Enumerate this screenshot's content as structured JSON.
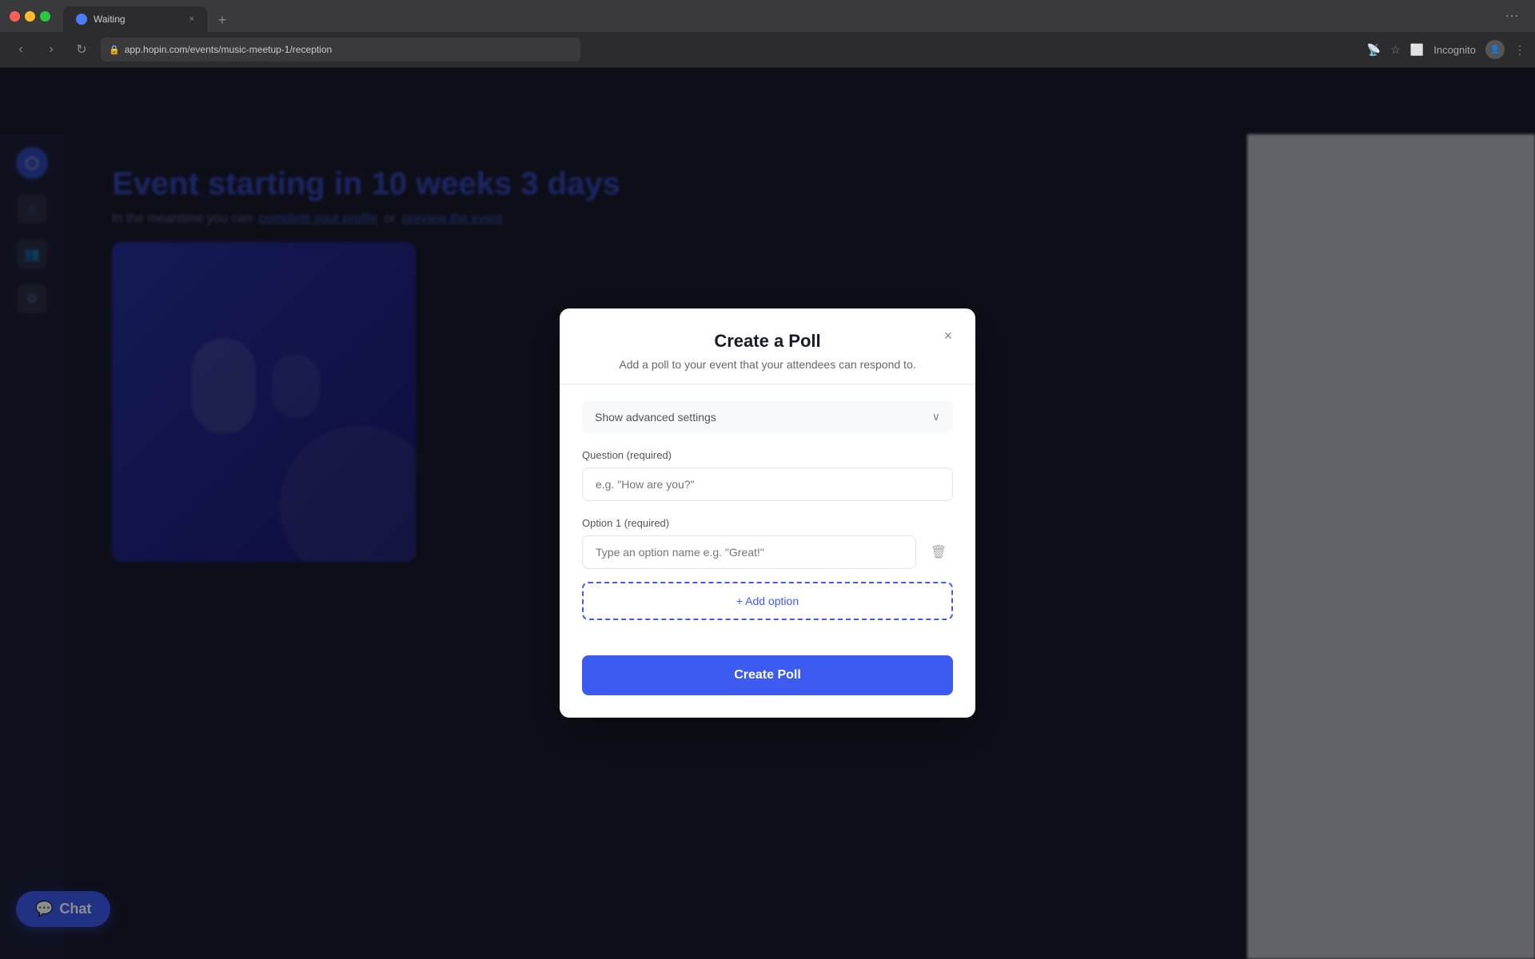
{
  "browser": {
    "tab_title": "Waiting",
    "url": "app.hopin.com/events/music-meetup-1/reception",
    "tab_close": "×",
    "tab_new": "+",
    "nav_back": "‹",
    "nav_forward": "›",
    "nav_refresh": "↻",
    "incognito_label": "Incognito",
    "more_icon": "⋮",
    "chevron_down": "⌄"
  },
  "page": {
    "event_title": "Event starting in 10 weeks 3 days",
    "event_subtitle_prefix": "In the meantime you can",
    "event_subtitle_link1": "complete your profile",
    "event_subtitle_mid": "or",
    "event_subtitle_link2": "preview the event"
  },
  "chat_button": {
    "label": "Chat",
    "icon": "💬"
  },
  "modal": {
    "title": "Create a Poll",
    "subtitle": "Add a poll to your event that your attendees can respond to.",
    "close_icon": "×",
    "advanced_settings_label": "Show advanced settings",
    "chevron_icon": "∨",
    "question_label": "Question (required)",
    "question_placeholder": "e.g. \"How are you?\"",
    "option1_label": "Option 1 (required)",
    "option1_placeholder": "Type an option name e.g. \"Great!\"",
    "add_option_label": "+ Add option",
    "create_poll_label": "Create Poll",
    "delete_icon": "🗑"
  },
  "colors": {
    "accent": "#3d5af1",
    "border": "#e0e4ea",
    "bg_light": "#f8f9fa",
    "text_dark": "#1a1a2e",
    "text_muted": "#666"
  }
}
